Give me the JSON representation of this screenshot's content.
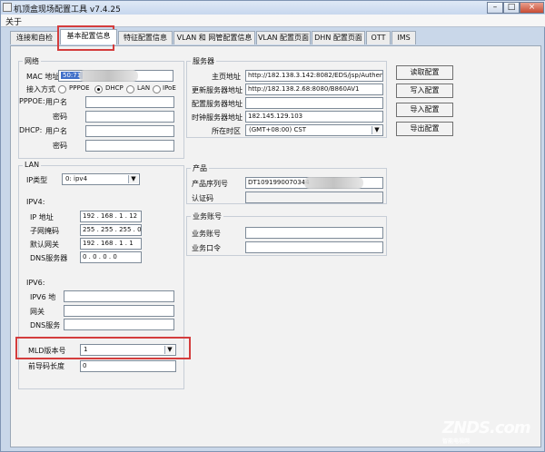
{
  "window": {
    "title": "机顶盒现场配置工具 v7.4.25"
  },
  "menu": {
    "about": "关于"
  },
  "tabs": [
    {
      "label": "连接和自检",
      "active": false
    },
    {
      "label": "基本配置信息",
      "active": true
    },
    {
      "label": "特征配置信息",
      "active": false
    },
    {
      "label": "VLAN 和 网管配置信息",
      "active": false
    },
    {
      "label": "VLAN 配置页面",
      "active": false
    },
    {
      "label": "DHN 配置页面",
      "active": false
    },
    {
      "label": "OTT",
      "active": false
    },
    {
      "label": "IMS",
      "active": false
    }
  ],
  "network": {
    "title": "网络",
    "mac_label": "MAC 地址",
    "mac_value": "50:71",
    "access_label": "接入方式",
    "access_options": [
      "PPPOE",
      "DHCP",
      "LAN",
      "IPoE"
    ],
    "access_selected": "DHCP",
    "pppoe_label": "PPPOE:",
    "pppoe_user_label": "用户名",
    "pppoe_pass_label": "密码",
    "dhcp_label": "DHCP:",
    "dhcp_user_label": "用户名",
    "dhcp_pass_label": "密码"
  },
  "server": {
    "title": "服务器",
    "home_label": "主页地址",
    "home_value": "http://182.138.3.142:8082/EDS/jsp/Authen",
    "update_label": "更新服务器地址",
    "update_value": "http://182.138.2.68:8080/B860AV1",
    "config_label": "配置服务器地址",
    "config_value": "",
    "time_label": "时钟服务器地址",
    "time_value": "182.145.129.103",
    "timezone_label": "所在时区",
    "timezone_value": "(GMT+08:00) CST"
  },
  "buttons": {
    "read": "读取配置",
    "write": "写入配置",
    "import": "导入配置",
    "export": "导出配置"
  },
  "lan": {
    "title": "LAN",
    "ip_type_label": "IP类型",
    "ip_type_value": "0: ipv4",
    "ipv4_title": "IPV4:",
    "ip_label": "IP 地址",
    "ip_value": "192 . 168 . 1 . 12",
    "mask_label": "子网掩码",
    "mask_value": "255 . 255 . 255 . 0",
    "gateway_label": "默认网关",
    "gateway_value": "192 . 168 . 1 . 1",
    "dns_label": "DNS服务器",
    "dns_value": "0 . 0 . 0 . 0",
    "ipv6_title": "IPV6:",
    "ipv6_addr_label": "IPV6 地",
    "ipv6_gateway_label": "网关",
    "ipv6_dns_label": "DNS服务",
    "mld_label": "MLD版本号",
    "mld_value": "1",
    "prefix_label": "前导码长度",
    "prefix_value": "0"
  },
  "product": {
    "title": "产品",
    "serial_label": "产品序列号",
    "serial_value": "DT1091990070344",
    "auth_label": "认证码",
    "auth_value": ""
  },
  "business": {
    "title": "业务账号",
    "account_label": "业务账号",
    "password_label": "业务口令"
  },
  "watermark": {
    "text": "ZNDS.com",
    "sub": "智能电视网"
  }
}
